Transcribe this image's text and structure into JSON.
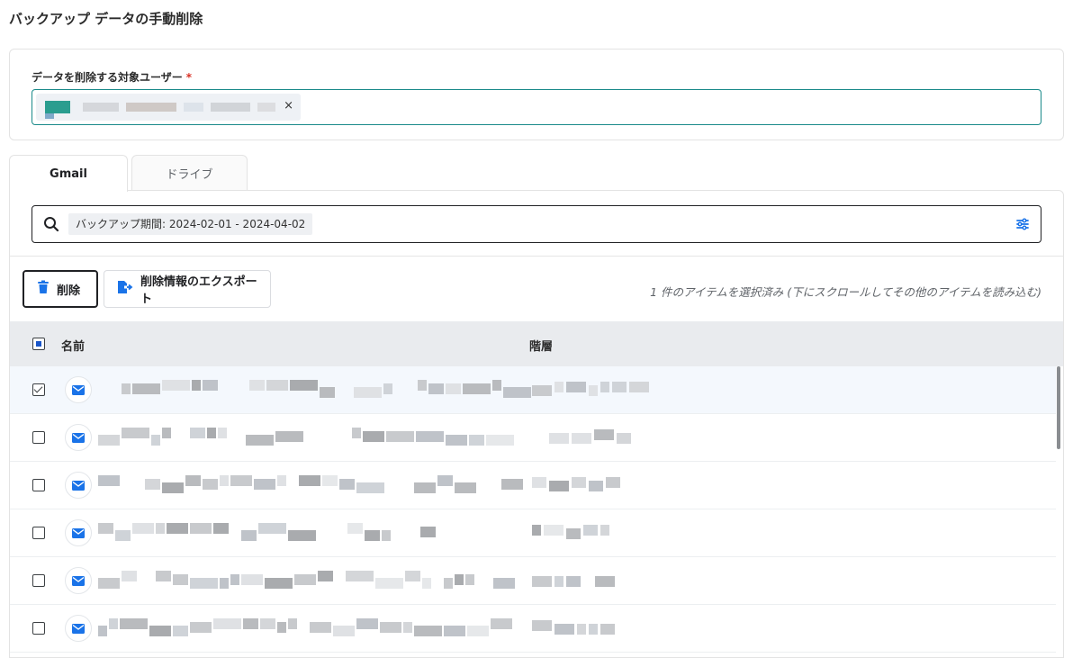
{
  "page": {
    "title": "バックアップ データの手動削除"
  },
  "user_field": {
    "label": "データを削除する対象ユーザー",
    "required_mark": "*",
    "chip_close": "×"
  },
  "tabs": [
    {
      "label": "Gmail",
      "active": true
    },
    {
      "label": "ドライブ",
      "active": false
    }
  ],
  "search": {
    "filter_label": "バックアップ期間: 2024-02-01 - 2024-04-02"
  },
  "actions": {
    "delete_label": "削除",
    "export_label": "削除情報のエクスポート"
  },
  "selection_status": "1 件のアイテムを選択済み (下にスクロールしてその他のアイテムを読み込む)",
  "table": {
    "columns": [
      "名前",
      "階層"
    ],
    "header_checkbox": "indeterminate",
    "rows": [
      {
        "checked": true,
        "icon": "mail-icon"
      },
      {
        "checked": false,
        "icon": "mail-icon"
      },
      {
        "checked": false,
        "icon": "mail-icon"
      },
      {
        "checked": false,
        "icon": "mail-icon"
      },
      {
        "checked": false,
        "icon": "mail-icon"
      },
      {
        "checked": false,
        "icon": "mail-icon"
      }
    ]
  },
  "colors": {
    "accent_blue": "#1a73e8",
    "focus_teal": "#1a8a8a",
    "required_red": "#d93025",
    "header_bg": "#e9ebee"
  }
}
